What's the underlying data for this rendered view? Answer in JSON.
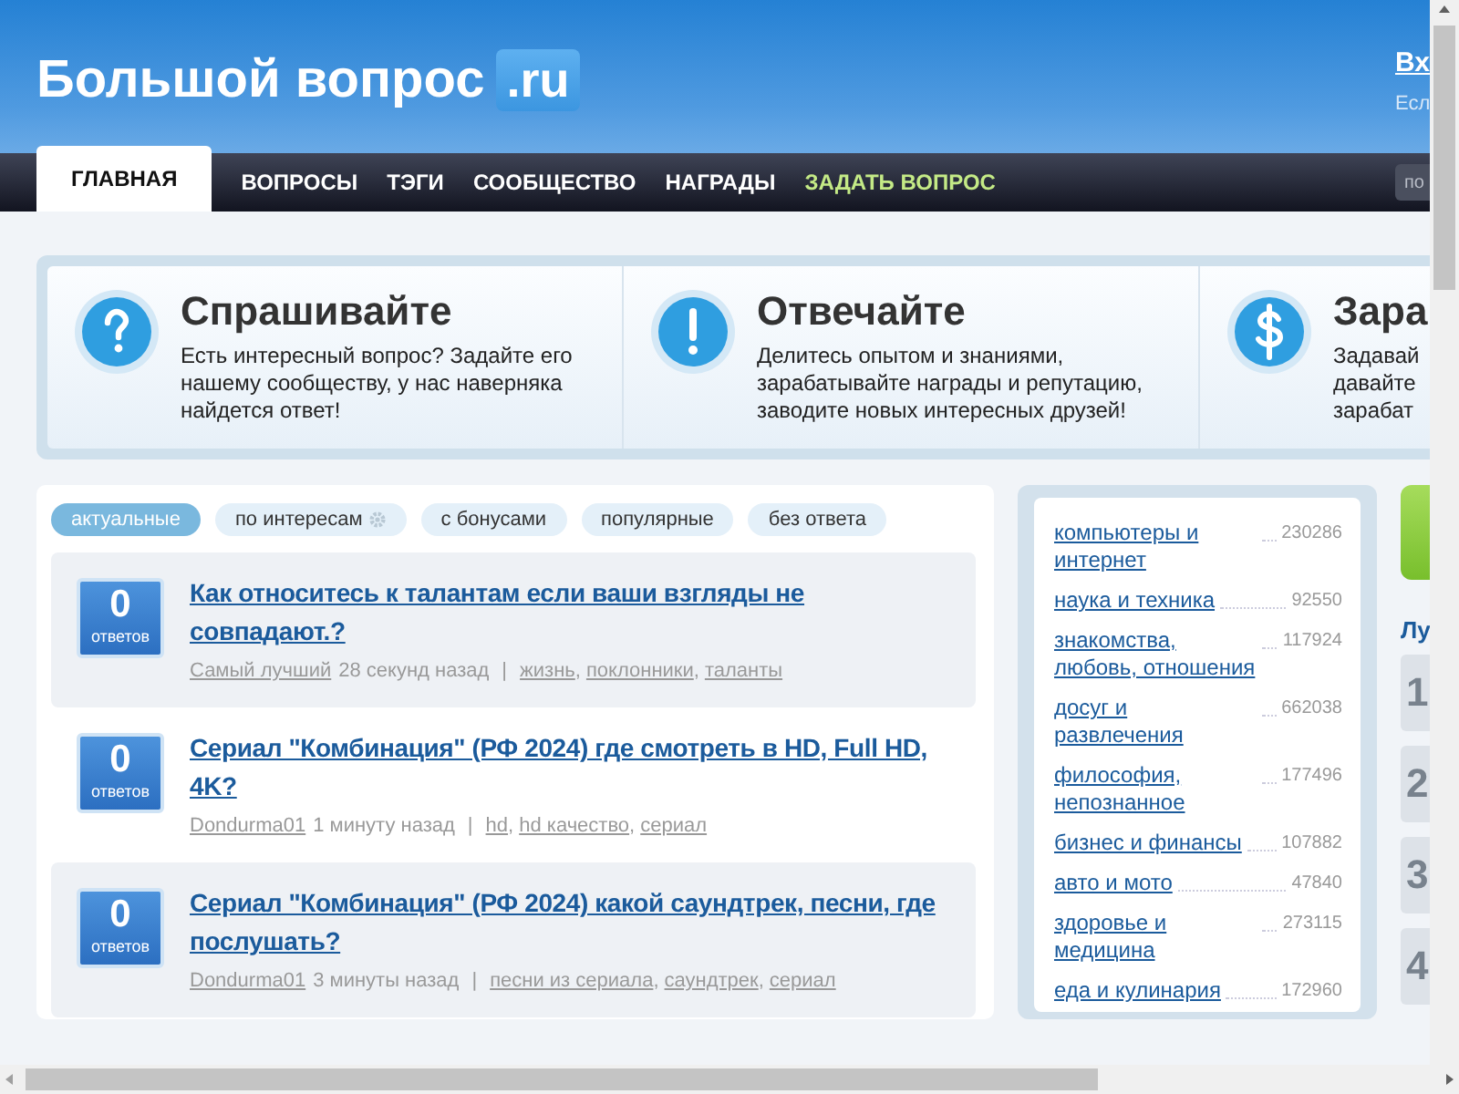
{
  "header": {
    "logo": {
      "name": "Большой вопрос",
      "tld": ".ru"
    },
    "login": {
      "link": "Вх",
      "note": "Есл"
    }
  },
  "nav": {
    "tabs": [
      {
        "label": "ГЛАВНАЯ",
        "selected": true,
        "kind": "normal"
      },
      {
        "label": "ВОПРОСЫ",
        "selected": false,
        "kind": "normal"
      },
      {
        "label": "ТЭГИ",
        "selected": false,
        "kind": "normal"
      },
      {
        "label": "СООБЩЕСТВО",
        "selected": false,
        "kind": "normal"
      },
      {
        "label": "НАГРАДЫ",
        "selected": false,
        "kind": "normal"
      },
      {
        "label": "ЗАДАТЬ ВОПРОС",
        "selected": false,
        "kind": "accent"
      }
    ],
    "search": {
      "placeholder": "по"
    }
  },
  "features": [
    {
      "kind": "ask",
      "title": "Спрашивайте",
      "lines": [
        "Есть интересный вопрос? Задайте его",
        "нашему сообществу, у нас наверняка",
        "найдется ответ!"
      ]
    },
    {
      "kind": "answer",
      "title": "Отвечайте",
      "lines": [
        "Делитесь опытом и знаниями,",
        "зарабатывайте награды и репутацию,",
        "заводите новых интересных друзей!"
      ]
    },
    {
      "kind": "earn",
      "title": "Зара",
      "lines": [
        "Задавай",
        "давайте",
        "зарабат"
      ]
    }
  ],
  "filters": [
    {
      "label": "актуальные",
      "selected": true,
      "settings_icon": false
    },
    {
      "label": "по интересам",
      "selected": false,
      "settings_icon": true
    },
    {
      "label": "с бонусами",
      "selected": false,
      "settings_icon": false
    },
    {
      "label": "популярные",
      "selected": false,
      "settings_icon": false
    },
    {
      "label": "без ответа",
      "selected": false,
      "settings_icon": false
    }
  ],
  "questions": [
    {
      "answers": "0",
      "answers_label": "ответов",
      "title": "Как относитесь к талантам если ваши взгляды не совпадают.?",
      "author": "Самый лучший",
      "time": "28 секунд назад",
      "separator": "|",
      "tag_delimiter": ",",
      "tags": [
        "жизнь",
        "поклонники",
        "таланты"
      ],
      "highlighted": true
    },
    {
      "answers": "0",
      "answers_label": "ответов",
      "title": "Сериал \"Комбинация\" (РФ 2024) где смотреть в HD, Full HD, 4K?",
      "author": "Dondurma01",
      "time": "1 минуту назад",
      "separator": "|",
      "tag_delimiter": ",",
      "tags": [
        "hd",
        "hd качество",
        "сериал"
      ],
      "highlighted": false
    },
    {
      "answers": "0",
      "answers_label": "ответов",
      "title": "Сериал \"Комбинация\" (РФ 2024) какой саундтрек, песни, где послушать?",
      "author": "Dondurma01",
      "time": "3 минуты назад",
      "separator": "|",
      "tag_delimiter": ",",
      "tags": [
        "песни из сериала",
        "саундтрек",
        "сериал"
      ],
      "highlighted": true
    }
  ],
  "categories": [
    {
      "name": "компьютеры и интернет",
      "count": "230286"
    },
    {
      "name": "наука и техника",
      "count": "92550"
    },
    {
      "name": "знакомства, любовь, отношения",
      "count": "117924"
    },
    {
      "name": "досуг и развлечения",
      "count": "662038"
    },
    {
      "name": "философия, непознанное",
      "count": "177496"
    },
    {
      "name": "бизнес и финансы",
      "count": "107882"
    },
    {
      "name": "авто и мото",
      "count": "47840"
    },
    {
      "name": "здоровье и медицина",
      "count": "273115"
    },
    {
      "name": "еда и кулинария",
      "count": "172960"
    }
  ],
  "leaders": {
    "title": "Лу",
    "ranks": [
      "1",
      "2",
      "3",
      "4"
    ]
  }
}
